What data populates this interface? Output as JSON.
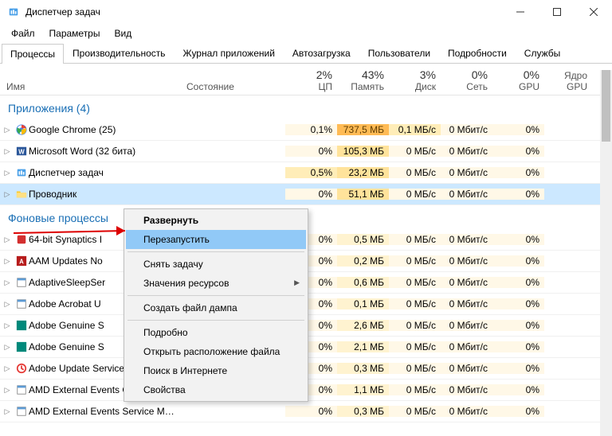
{
  "window": {
    "title": "Диспетчер задач"
  },
  "menu": {
    "file": "Файл",
    "options": "Параметры",
    "view": "Вид"
  },
  "tabs": {
    "items": [
      "Процессы",
      "Производительность",
      "Журнал приложений",
      "Автозагрузка",
      "Пользователи",
      "Подробности",
      "Службы"
    ],
    "active": 0
  },
  "columns": {
    "name": "Имя",
    "state": "Состояние",
    "cpu": {
      "pct": "2%",
      "label": "ЦП"
    },
    "memory": {
      "pct": "43%",
      "label": "Память"
    },
    "disk": {
      "pct": "3%",
      "label": "Диск"
    },
    "network": {
      "pct": "0%",
      "label": "Сеть"
    },
    "gpu": {
      "pct": "0%",
      "label": "GPU"
    },
    "gpu_engine": "Ядро GPU"
  },
  "groups": {
    "apps": {
      "title": "Приложения (4)"
    },
    "bg": {
      "title": "Фоновые процессы"
    }
  },
  "apps": [
    {
      "icon": "chrome",
      "name": "Google Chrome (25)",
      "cpu": "0,1%",
      "mem": "737,5 МБ",
      "mem_cls": "mem-h",
      "disk": "0,1 МБ/с",
      "disk_cls": "dsk-m",
      "net": "0 Мбит/с",
      "gpu": "0%"
    },
    {
      "icon": "word",
      "name": "Microsoft Word (32 бита)",
      "cpu": "0%",
      "mem": "105,3 МБ",
      "mem_cls": "mem-m",
      "disk": "0 МБ/с",
      "disk_cls": "dsk-l",
      "net": "0 Мбит/с",
      "gpu": "0%"
    },
    {
      "icon": "taskmgr",
      "name": "Диспетчер задач",
      "cpu": "0,5%",
      "cpu_cls": "cpu-m",
      "mem": "23,2 МБ",
      "mem_cls": "mem-m",
      "disk": "0 МБ/с",
      "disk_cls": "dsk-l",
      "net": "0 Мбит/с",
      "gpu": "0%"
    },
    {
      "icon": "explorer",
      "name": "Проводник",
      "cpu": "0%",
      "mem": "51,1 МБ",
      "mem_cls": "mem-m",
      "disk": "0 МБ/с",
      "disk_cls": "dsk-l",
      "net": "0 Мбит/с",
      "gpu": "0%",
      "selected": true
    }
  ],
  "bg": [
    {
      "icon": "syn",
      "name": "64-bit Synaptics I",
      "cpu": "0%",
      "mem": "0,5 МБ",
      "disk": "0 МБ/с",
      "net": "0 Мбит/с",
      "gpu": "0%"
    },
    {
      "icon": "adobe-a",
      "name": "AAM Updates No",
      "cpu": "0%",
      "mem": "0,2 МБ",
      "disk": "0 МБ/с",
      "net": "0 Мбит/с",
      "gpu": "0%"
    },
    {
      "icon": "generic",
      "name": "AdaptiveSleepSer",
      "cpu": "0%",
      "mem": "0,6 МБ",
      "disk": "0 МБ/с",
      "net": "0 Мбит/с",
      "gpu": "0%"
    },
    {
      "icon": "generic",
      "name": "Adobe Acrobat U",
      "cpu": "0%",
      "mem": "0,1 МБ",
      "disk": "0 МБ/с",
      "net": "0 Мбит/с",
      "gpu": "0%"
    },
    {
      "icon": "adobe-g",
      "name": "Adobe Genuine S",
      "cpu": "0%",
      "mem": "2,6 МБ",
      "disk": "0 МБ/с",
      "net": "0 Мбит/с",
      "gpu": "0%"
    },
    {
      "icon": "adobe-g",
      "name": "Adobe Genuine S",
      "cpu": "0%",
      "mem": "2,1 МБ",
      "disk": "0 МБ/с",
      "net": "0 Мбит/с",
      "gpu": "0%"
    },
    {
      "icon": "adobe-u",
      "name": "Adobe Update Service (32 бита)",
      "cpu": "0%",
      "mem": "0,3 МБ",
      "disk": "0 МБ/с",
      "net": "0 Мбит/с",
      "gpu": "0%"
    },
    {
      "icon": "generic",
      "name": "AMD External Events Client Mo…",
      "cpu": "0%",
      "mem": "1,1 МБ",
      "disk": "0 МБ/с",
      "net": "0 Мбит/с",
      "gpu": "0%"
    },
    {
      "icon": "generic",
      "name": "AMD External Events Service Mo…",
      "cpu": "0%",
      "mem": "0,3 МБ",
      "disk": "0 МБ/с",
      "net": "0 Мбит/с",
      "gpu": "0%"
    }
  ],
  "context_menu": {
    "expand": "Развернуть",
    "restart": "Перезапустить",
    "end_task": "Снять задачу",
    "resource_values": "Значения ресурсов",
    "create_dump": "Создать файл дампа",
    "details": "Подробно",
    "open_location": "Открыть расположение файла",
    "search_online": "Поиск в Интернете",
    "properties": "Свойства"
  }
}
